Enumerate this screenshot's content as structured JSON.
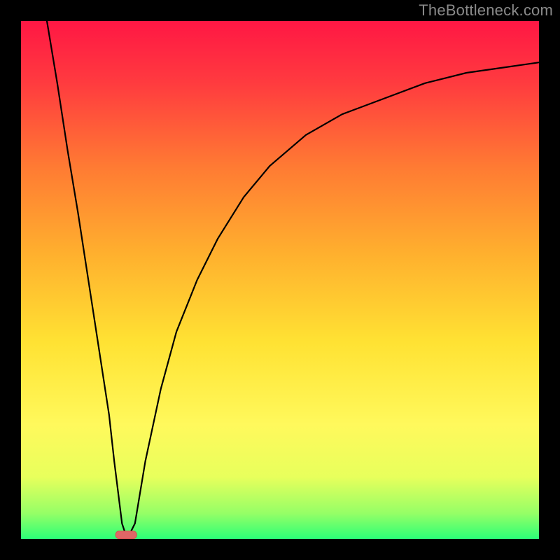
{
  "watermark": "TheBottleneck.com",
  "chart_data": {
    "type": "line",
    "title": "",
    "xlabel": "",
    "ylabel": "",
    "xlim": [
      0,
      100
    ],
    "ylim": [
      0,
      100
    ],
    "notes": "Background is a vertical gradient from red through orange and yellow to green; black curve starts near 100% at x≈5, drops to 0 near x≈20, then rises asymptotically toward ~92 at x=100; small red marker at the minimum.",
    "curve": {
      "x": [
        5,
        7,
        9,
        11,
        13,
        15,
        17,
        18,
        19.5,
        20.5,
        22,
        24,
        27,
        30,
        34,
        38,
        43,
        48,
        55,
        62,
        70,
        78,
        86,
        93,
        100
      ],
      "y": [
        100,
        88,
        75,
        63,
        50,
        37,
        24,
        15,
        3,
        0,
        3,
        15,
        29,
        40,
        50,
        58,
        66,
        72,
        78,
        82,
        85,
        88,
        90,
        91,
        92
      ]
    },
    "marker": {
      "x": 20.3,
      "y": 0.8
    },
    "gradient_stops": [
      {
        "offset": 0,
        "color": "#ff1744"
      },
      {
        "offset": 12,
        "color": "#ff3b3f"
      },
      {
        "offset": 28,
        "color": "#ff7a33"
      },
      {
        "offset": 45,
        "color": "#ffb02e"
      },
      {
        "offset": 62,
        "color": "#ffe233"
      },
      {
        "offset": 78,
        "color": "#fff95c"
      },
      {
        "offset": 88,
        "color": "#e8ff5c"
      },
      {
        "offset": 95,
        "color": "#96ff66"
      },
      {
        "offset": 100,
        "color": "#2bff77"
      }
    ]
  }
}
